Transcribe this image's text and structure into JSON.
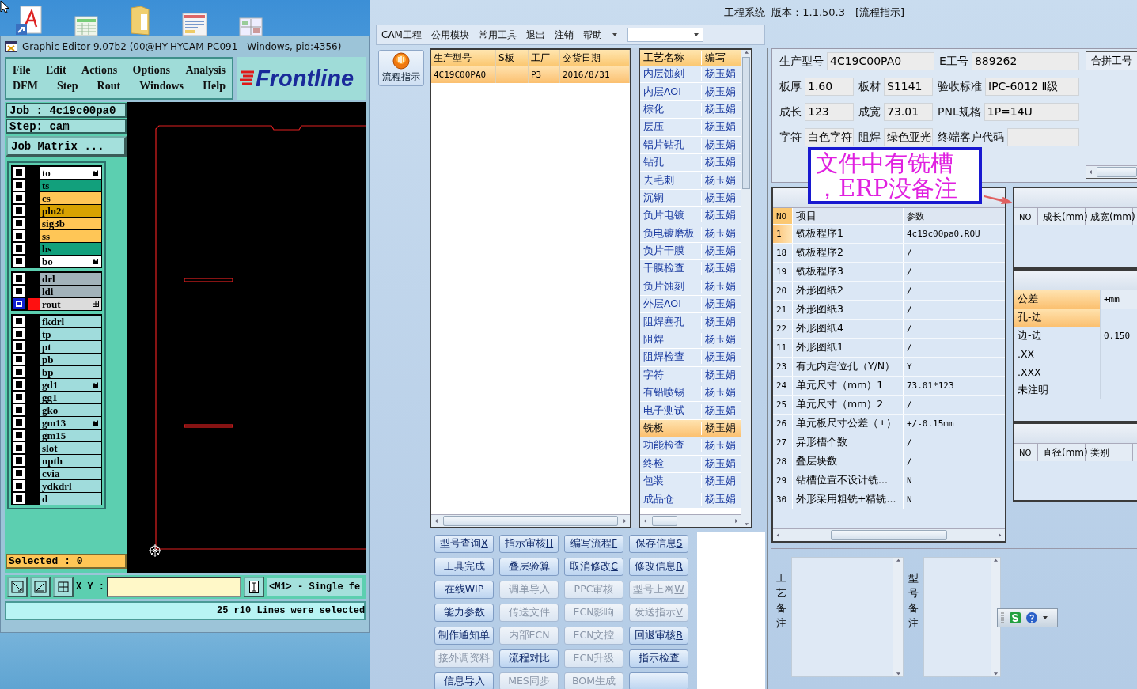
{
  "editor": {
    "title": "Graphic Editor 9.07b2 (00@HY-HYCAM-PC091 - Windows, pid:4356)",
    "menu": [
      [
        "File",
        "Edit",
        "Actions",
        "Options",
        "Analysis"
      ],
      [
        "DFM",
        "Step",
        "Rout",
        "Windows",
        "Help"
      ]
    ],
    "logo": "Frontline",
    "job": "Job : 4c19c00pa0",
    "step": "Step: cam",
    "matrix_button": "Job Matrix ...",
    "layer_groups": [
      [
        {
          "name": "to",
          "color": "#ffffff",
          "kind": "hand",
          "selected": false
        },
        {
          "name": "ts",
          "color": "#12a07c",
          "kind": "plain",
          "selected": false
        },
        {
          "name": "cs",
          "color": "#ffc656",
          "kind": "plain",
          "selected": false
        },
        {
          "name": "pln2t",
          "color": "#d8a200",
          "kind": "plain",
          "selected": false
        },
        {
          "name": "sig3b",
          "color": "#ffc656",
          "kind": "plain",
          "selected": false
        },
        {
          "name": "ss",
          "color": "#ffc656",
          "kind": "plain",
          "selected": false
        },
        {
          "name": "bs",
          "color": "#12a07c",
          "kind": "plain",
          "selected": false
        },
        {
          "name": "bo",
          "color": "#ffffff",
          "kind": "hand",
          "selected": false
        }
      ],
      [
        {
          "name": "drl",
          "color": "#a2b2ba",
          "kind": "plain",
          "selected": false
        },
        {
          "name": "ldi",
          "color": "#a2b2ba",
          "kind": "plain",
          "selected": false
        },
        {
          "name": "rout",
          "color": "#dcdcdc",
          "kind": "grid",
          "selected": true
        }
      ],
      [
        {
          "name": "fkdrl",
          "color": "#a0dcdc",
          "kind": "plain",
          "selected": false
        },
        {
          "name": "tp",
          "color": "#a0dcdc",
          "kind": "plain",
          "selected": false
        },
        {
          "name": "pt",
          "color": "#a0dcdc",
          "kind": "plain",
          "selected": false
        },
        {
          "name": "pb",
          "color": "#a0dcdc",
          "kind": "plain",
          "selected": false
        },
        {
          "name": "bp",
          "color": "#a0dcdc",
          "kind": "plain",
          "selected": false
        },
        {
          "name": "gd1",
          "color": "#a0dcdc",
          "kind": "hand",
          "selected": false
        },
        {
          "name": "gg1",
          "color": "#a0dcdc",
          "kind": "plain",
          "selected": false
        },
        {
          "name": "gko",
          "color": "#a0dcdc",
          "kind": "plain",
          "selected": false
        },
        {
          "name": "gm13",
          "color": "#a0dcdc",
          "kind": "hand",
          "selected": false
        },
        {
          "name": "gm15",
          "color": "#a0dcdc",
          "kind": "plain",
          "selected": false
        },
        {
          "name": "slot",
          "color": "#a0dcdc",
          "kind": "plain",
          "selected": false
        },
        {
          "name": "npth",
          "color": "#a0dcdc",
          "kind": "plain",
          "selected": false
        },
        {
          "name": "cvia",
          "color": "#a0dcdc",
          "kind": "plain",
          "selected": false
        },
        {
          "name": "ydkdrl",
          "color": "#a0dcdc",
          "kind": "plain",
          "selected": false
        },
        {
          "name": "d",
          "color": "#a0dcdc",
          "kind": "plain",
          "selected": false
        }
      ]
    ],
    "selected_count": "Selected : 0",
    "coord_label": "X Y :",
    "mode": "<M1> - Single fe",
    "status": "25 r10 Lines were selected"
  },
  "erp": {
    "title": "工程系统  版本：1.1.50.3 - [流程指示]",
    "menu": [
      "CAM工程",
      "公用模块",
      "常用工具",
      "退出",
      "注销",
      "帮助"
    ],
    "nav_button": "流程指示",
    "orders": {
      "columns": [
        "生产型号",
        "S板",
        "工厂",
        "交货日期"
      ],
      "rows": [
        {
          "cells": [
            "4C19C00PA0",
            "",
            "P3",
            "2016/8/31"
          ],
          "selected": true
        }
      ]
    },
    "processes": {
      "columns": [
        "工艺名称",
        "编写"
      ],
      "rows": [
        {
          "name": "内层蚀刻",
          "writer": "杨玉娟",
          "selected": false
        },
        {
          "name": "内层AOI",
          "writer": "杨玉娟",
          "selected": false
        },
        {
          "name": "棕化",
          "writer": "杨玉娟",
          "selected": false
        },
        {
          "name": "层压",
          "writer": "杨玉娟",
          "selected": false
        },
        {
          "name": "铝片钻孔",
          "writer": "杨玉娟",
          "selected": false
        },
        {
          "name": "钻孔",
          "writer": "杨玉娟",
          "selected": false
        },
        {
          "name": "去毛刺",
          "writer": "杨玉娟",
          "selected": false
        },
        {
          "name": "沉铜",
          "writer": "杨玉娟",
          "selected": false
        },
        {
          "name": "负片电镀",
          "writer": "杨玉娟",
          "selected": false
        },
        {
          "name": "负电镀磨板",
          "writer": "杨玉娟",
          "selected": false
        },
        {
          "name": "负片干膜",
          "writer": "杨玉娟",
          "selected": false
        },
        {
          "name": "干膜检查",
          "writer": "杨玉娟",
          "selected": false
        },
        {
          "name": "负片蚀刻",
          "writer": "杨玉娟",
          "selected": false
        },
        {
          "name": "外层AOI",
          "writer": "杨玉娟",
          "selected": false
        },
        {
          "name": "阻焊塞孔",
          "writer": "杨玉娟",
          "selected": false
        },
        {
          "name": "阻焊",
          "writer": "杨玉娟",
          "selected": false
        },
        {
          "name": "阻焊检查",
          "writer": "杨玉娟",
          "selected": false
        },
        {
          "name": "字符",
          "writer": "杨玉娟",
          "selected": false
        },
        {
          "name": "有铅喷锡",
          "writer": "杨玉娟",
          "selected": false
        },
        {
          "name": "电子测试",
          "writer": "杨玉娟",
          "selected": false
        },
        {
          "name": "铣板",
          "writer": "杨玉娟",
          "selected": true
        },
        {
          "name": "功能检查",
          "writer": "杨玉娟",
          "selected": false
        },
        {
          "name": "终检",
          "writer": "杨玉娟",
          "selected": false
        },
        {
          "name": "包装",
          "writer": "杨玉娟",
          "selected": false
        },
        {
          "name": "成品仓",
          "writer": "杨玉娟",
          "selected": false
        }
      ]
    },
    "buttons": [
      {
        "label": "型号查询",
        "shortcut": "X",
        "disabled": false
      },
      {
        "label": "指示审核",
        "shortcut": "H",
        "disabled": false
      },
      {
        "label": "编写流程",
        "shortcut": "F",
        "disabled": false
      },
      {
        "label": "保存信息",
        "shortcut": "S",
        "disabled": false
      },
      {
        "label": "工具完成",
        "disabled": false
      },
      {
        "label": "叠层验算",
        "disabled": false
      },
      {
        "label": "取消修改",
        "shortcut": "C",
        "disabled": false
      },
      {
        "label": "修改信息",
        "shortcut": "R",
        "disabled": false
      },
      {
        "label": "在线WIP",
        "disabled": false
      },
      {
        "label": "调单导入",
        "disabled": true
      },
      {
        "label": "PPC审核",
        "disabled": true
      },
      {
        "label": "型号上网",
        "shortcut": "W",
        "disabled": true
      },
      {
        "label": "能力参数",
        "disabled": false
      },
      {
        "label": "传送文件",
        "disabled": true
      },
      {
        "label": "ECN影响",
        "disabled": true
      },
      {
        "label": "发送指示",
        "shortcut": "V",
        "disabled": true
      },
      {
        "label": "制作通知单",
        "disabled": false
      },
      {
        "label": "内部ECN",
        "disabled": true
      },
      {
        "label": "ECN文控",
        "disabled": true
      },
      {
        "label": "回退审核",
        "shortcut": "B",
        "disabled": false
      },
      {
        "label": "接外调资料",
        "disabled": true
      },
      {
        "label": "流程对比",
        "disabled": false
      },
      {
        "label": "ECN升级",
        "disabled": true
      },
      {
        "label": "指示检查",
        "disabled": false
      },
      {
        "label": "信息导入",
        "disabled": false
      },
      {
        "label": "MES同步",
        "disabled": true
      },
      {
        "label": "BOM生成",
        "disabled": true
      }
    ],
    "info": {
      "fields": [
        {
          "label": "生产型号",
          "value": "4C19C00PA0"
        },
        {
          "label": "E工号",
          "value": "889262"
        },
        {
          "label": "板厚",
          "value": "1.60"
        },
        {
          "label": "板材",
          "value": "S1141"
        },
        {
          "label": "验收标准",
          "value": "IPC-6012 Ⅱ级"
        },
        {
          "label": "成长",
          "value": "123"
        },
        {
          "label": "成宽",
          "value": "73.01"
        },
        {
          "label": "PNL规格",
          "value": "1P=14U"
        },
        {
          "label": "字符",
          "value": "白色字符"
        },
        {
          "label": "阻焊",
          "value": "绿色亚光"
        },
        {
          "label": "终端客户代码"
        }
      ]
    },
    "merge_list": {
      "column": "合拼工号"
    },
    "params": {
      "columns": [
        "NO",
        "项目",
        "参数"
      ],
      "rows": [
        {
          "no": "1",
          "item": "铣板程序1",
          "value": "4c19c00pa0.ROU",
          "selected": true
        },
        {
          "no": "18",
          "item": "铣板程序2",
          "value": "/",
          "selected": false
        },
        {
          "no": "19",
          "item": "铣板程序3",
          "value": "/",
          "selected": false
        },
        {
          "no": "20",
          "item": "外形图纸2",
          "value": "/",
          "selected": false
        },
        {
          "no": "21",
          "item": "外形图纸3",
          "value": "/",
          "selected": false
        },
        {
          "no": "22",
          "item": "外形图纸4",
          "value": "/",
          "selected": false
        },
        {
          "no": "11",
          "item": "外形图纸1",
          "value": "/",
          "selected": false
        },
        {
          "no": "23",
          "item": "有无内定位孔（Y/N）",
          "value": "Y",
          "selected": false
        },
        {
          "no": "24",
          "item": "单元尺寸（mm）1",
          "value": "73.01*123",
          "selected": false
        },
        {
          "no": "25",
          "item": "单元尺寸（mm）2",
          "value": "/",
          "selected": false
        },
        {
          "no": "26",
          "item": "单元板尺寸公差（±）",
          "value": "+/-0.15mm",
          "selected": false
        },
        {
          "no": "27",
          "item": "异形槽个数",
          "value": "/",
          "selected": false
        },
        {
          "no": "28",
          "item": "叠层块数",
          "value": "/",
          "selected": false
        },
        {
          "no": "29",
          "item": "钻槽位置不设计铣...",
          "value": "N",
          "selected": false
        },
        {
          "no": "30",
          "item": "外形采用粗铣+精铣...",
          "value": "N",
          "selected": false
        }
      ]
    },
    "mill_table": {
      "columns": [
        "NO",
        "成长(mm)",
        "成宽(mm)"
      ]
    },
    "tolerance": {
      "columns": [
        "公差",
        "+mm"
      ],
      "rows": [
        {
          "name": "孔-边",
          "selected": true
        },
        {
          "name": "边-边",
          "value": "0.150",
          "selected": false
        },
        {
          "name": ".XX",
          "selected": false
        },
        {
          "name": ".XXX",
          "selected": false
        },
        {
          "name": "未注明",
          "selected": false
        }
      ]
    },
    "drill_table": {
      "columns": [
        "NO",
        "直径(mm)",
        "类别"
      ]
    },
    "remarks": [
      "工艺备注",
      "型号备注"
    ],
    "callout": "文件中有铣槽，ERP没备注"
  }
}
